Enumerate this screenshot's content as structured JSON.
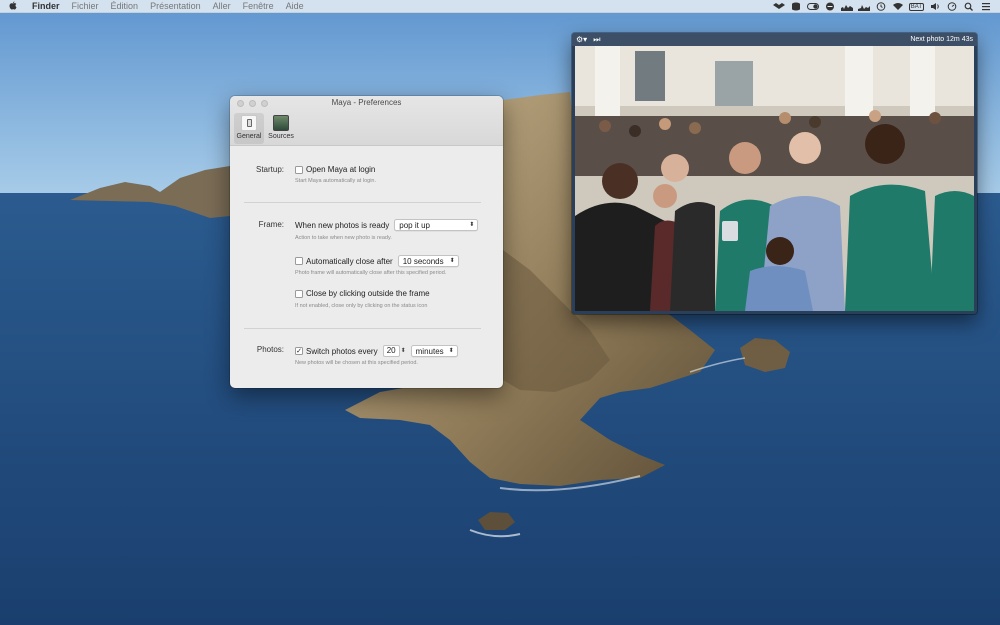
{
  "menubar": {
    "apple_icon": "apple-logo-icon",
    "app_name": "Finder",
    "menus": [
      "Fichier",
      "Édition",
      "Présentation",
      "Aller",
      "Fenêtre",
      "Aide"
    ],
    "status_icons": [
      "dropbox-icon",
      "stack-icon",
      "toggle-icon",
      "keyboard-icon",
      "cpu-graph-icon",
      "network-graph-icon",
      "time-machine-icon",
      "wifi-icon",
      "battery-icon",
      "volume-icon",
      "timer-icon",
      "search-icon",
      "menu-list-icon"
    ],
    "battery_label": "BAT"
  },
  "prefs": {
    "title": "Maya - Preferences",
    "tabs": [
      {
        "label": "General",
        "icon": "general-switch-icon",
        "active": true
      },
      {
        "label": "Sources",
        "icon": "sources-photo-icon",
        "active": false
      }
    ],
    "startup": {
      "label": "Startup:",
      "open_login": "Open Maya at login",
      "open_login_checked": false,
      "open_login_help": "Start Maya automatically at login."
    },
    "frame": {
      "label": "Frame:",
      "new_photos": "When new photos is ready",
      "new_photos_value": "pop it up",
      "new_photos_help": "Action to take when new photo is ready.",
      "auto_close": "Automatically close after",
      "auto_close_checked": false,
      "auto_close_value": "10 seconds",
      "auto_close_help": "Photo frame will automatically close after this specified period.",
      "click_outside": "Close by clicking outside the frame",
      "click_outside_checked": false,
      "click_outside_help": "If not enabled, close only by clicking on the status icon"
    },
    "photos": {
      "label": "Photos:",
      "switch": "Switch photos every",
      "switch_checked": true,
      "check_mark": "✓",
      "interval": "20",
      "unit": "minutes",
      "help": "New photos will be chosen at this specified period."
    }
  },
  "photo_window": {
    "settings_icon": "gear-icon",
    "next_icon": "fast-forward-icon",
    "next_label": "Next photo 12m 43s",
    "colors": {
      "bar": "#3d4f66",
      "shirts": "#1f7a6a"
    }
  },
  "colors": {
    "sky": "#6fa6d8",
    "sea": "#1d4a80",
    "rock": "#a58f6a"
  }
}
